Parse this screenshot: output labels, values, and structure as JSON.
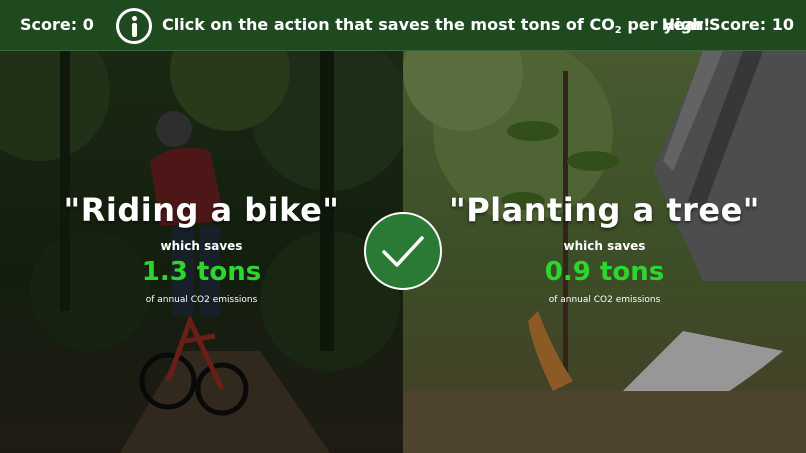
{
  "header": {
    "score_label": "Score: 0",
    "instruction_main": "Click on the action that saves the most tons of CO",
    "instruction_sub": "2",
    "instruction_end": " per year!",
    "high_score_label": "High Score: 10",
    "info_icon": "info-icon"
  },
  "options": [
    {
      "title": "\"Riding a bike\"",
      "which_saves": "which saves",
      "amount": "1.3 tons",
      "note": "of annual CO2 emissions",
      "image": "cyclist-on-forest-trail"
    },
    {
      "title": "\"Planting a tree\"",
      "which_saves": "which saves",
      "amount": "0.9 tons",
      "note": "of annual CO2 emissions",
      "image": "hands-planting-sapling"
    }
  ],
  "result_icon": "checkmark-icon",
  "colors": {
    "header_bg": "#1f4a20",
    "amount_green": "#2dd52d",
    "check_bg": "#2a7a36"
  }
}
